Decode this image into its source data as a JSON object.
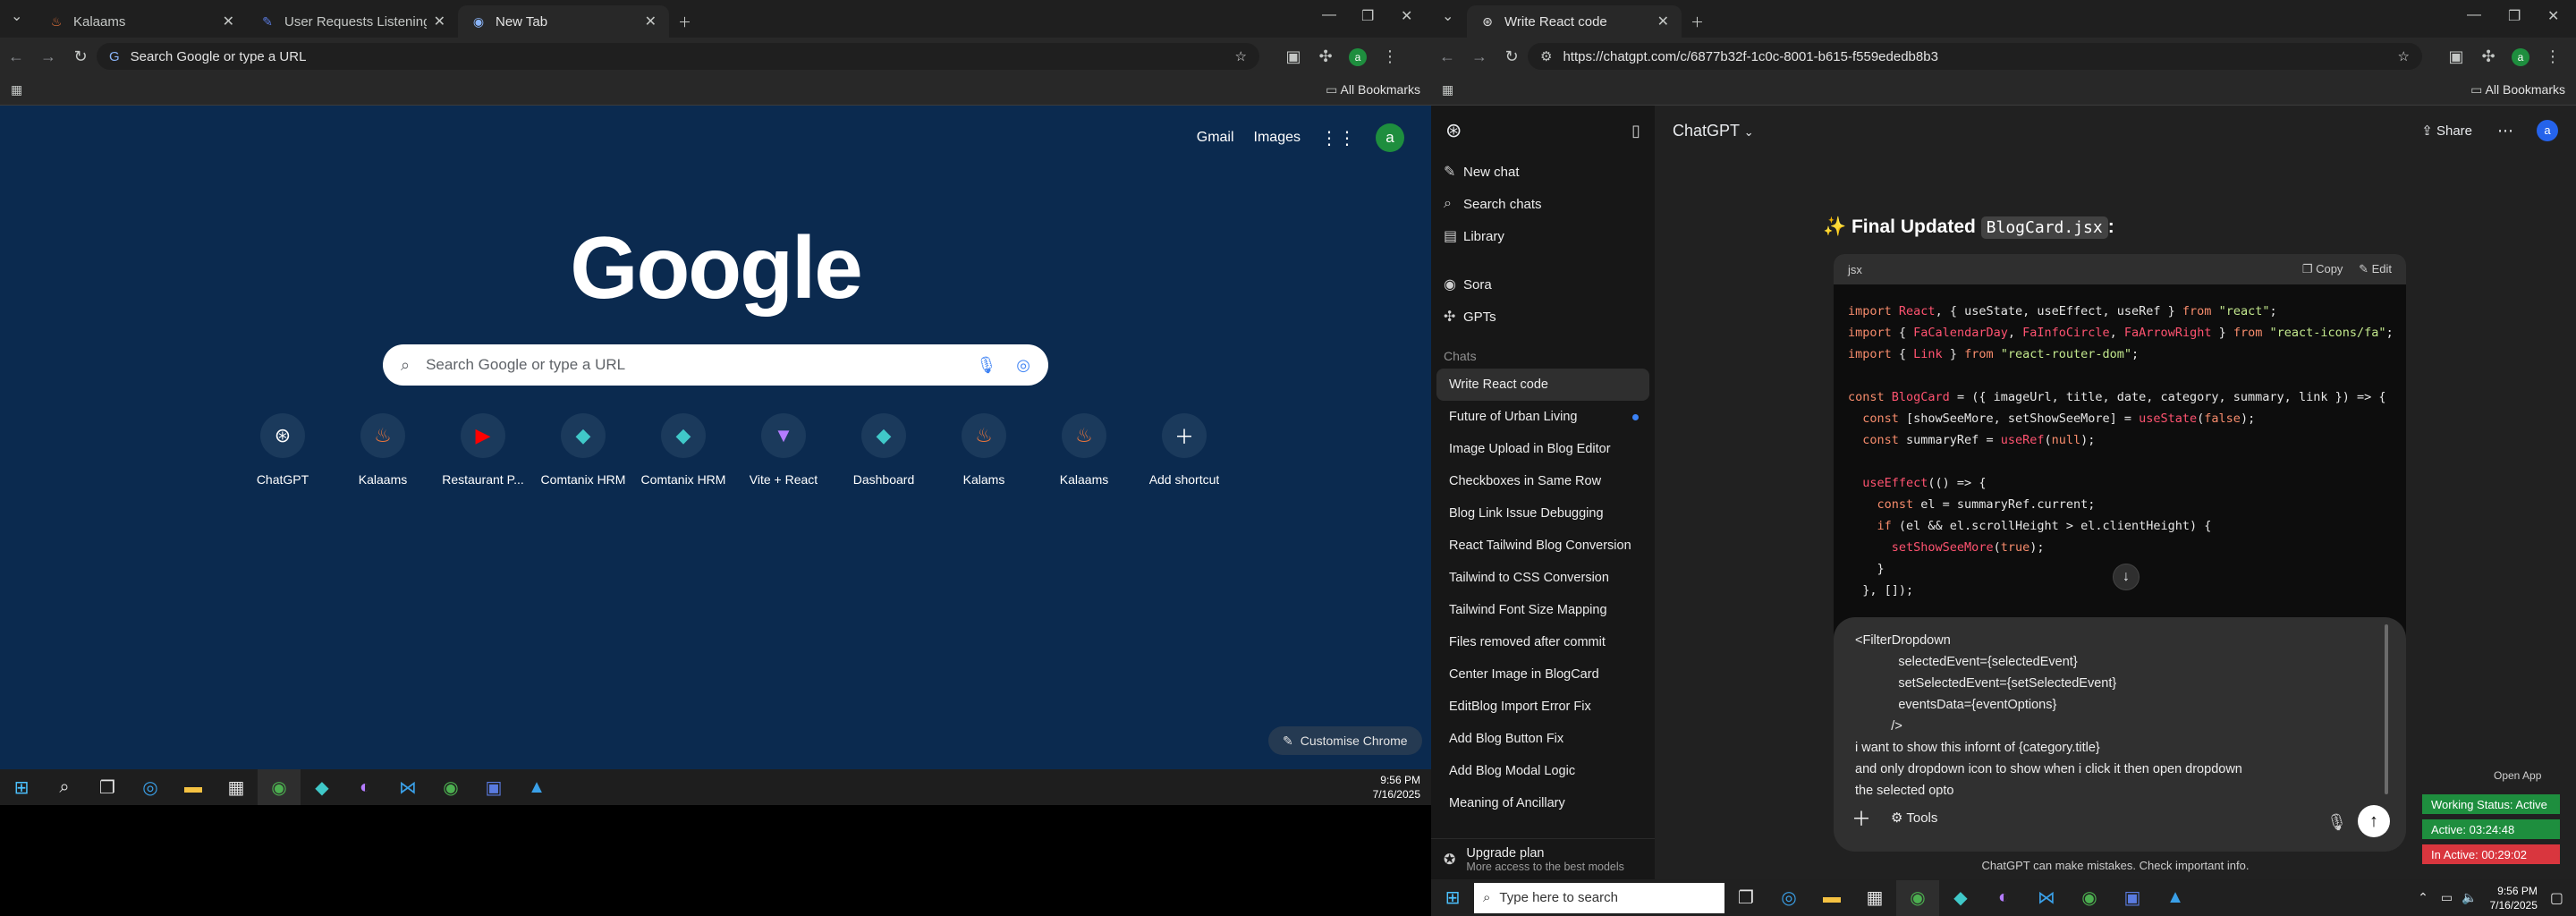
{
  "left_browser": {
    "tabs": [
      {
        "title": "Kalaams",
        "icon": "kalaams-icon"
      },
      {
        "title": "User Requests Listening Assista",
        "icon": "tools-icon"
      },
      {
        "title": "New Tab",
        "icon": "chrome-icon"
      }
    ],
    "address": "Search Google or type a URL",
    "bookmarks_label": "All Bookmarks",
    "new_tab": {
      "links": [
        "Gmail",
        "Images"
      ],
      "avatar": "a",
      "logo": "Google",
      "search_placeholder": "Search Google or type a URL",
      "shortcuts": [
        {
          "label": "ChatGPT",
          "icon": "chatgpt-icon"
        },
        {
          "label": "Kalaams",
          "icon": "kalaams-icon"
        },
        {
          "label": "Restaurant P...",
          "icon": "youtube-icon"
        },
        {
          "label": "Comtanix HRM",
          "icon": "hrm-icon"
        },
        {
          "label": "Comtanix HRM",
          "icon": "hrm-icon"
        },
        {
          "label": "Vite + React",
          "icon": "vite-icon"
        },
        {
          "label": "Dashboard",
          "icon": "hrm-icon"
        },
        {
          "label": "Kalams",
          "icon": "kalaams-icon"
        },
        {
          "label": "Kalaams",
          "icon": "kalaams-icon"
        },
        {
          "label": "Add shortcut",
          "icon": "plus-icon"
        }
      ],
      "customise": "Customise Chrome"
    },
    "clock": {
      "time": "9:56 PM",
      "date": "7/16/2025"
    }
  },
  "right_browser": {
    "tab_title": "Write React code",
    "url": "https://chatgpt.com/c/6877b32f-1c0c-8001-b615-f559ededb8b3",
    "bookmarks_label": "All Bookmarks",
    "sidebar": {
      "items": [
        "New chat",
        "Search chats",
        "Library",
        "Sora",
        "GPTs"
      ],
      "chats_label": "Chats",
      "chats": [
        "Write React code",
        "Future of Urban Living",
        "Image Upload in Blog Editor",
        "Checkboxes in Same Row",
        "Blog Link Issue Debugging",
        "React Tailwind Blog Conversion",
        "Tailwind to CSS Conversion",
        "Tailwind Font Size Mapping",
        "Files removed after commit",
        "Center Image in BlogCard",
        "EditBlog Import Error Fix",
        "Add Blog Button Fix",
        "Add Blog Modal Logic",
        "Meaning of Ancillary"
      ],
      "upgrade_title": "Upgrade plan",
      "upgrade_sub": "More access to the best models"
    },
    "main": {
      "model": "ChatGPT",
      "share": "Share",
      "heading_prefix": "✨ Final Updated",
      "heading_file": "BlogCard.jsx",
      "heading_suffix": ":",
      "code_lang": "jsx",
      "copy": "Copy",
      "edit": "Edit",
      "composer_text": "<FilterDropdown\n            selectedEvent={selectedEvent}\n            setSelectedEvent={setSelectedEvent}\n            eventsData={eventOptions}\n          />\ni want to show this infornt of {category.title}\nand only dropdown icon to show when i click it then open dropdown\nthe selected opto",
      "tools": "Tools",
      "disclaimer": "ChatGPT can make mistakes. Check important info."
    },
    "status": {
      "open_app": "Open App",
      "working": "Working Status: Active",
      "active": "Active: 03:24:48",
      "inactive": "In Active: 00:29:02"
    },
    "taskbar_search": "Type here to search",
    "clock": {
      "time": "9:56 PM",
      "date": "7/16/2025"
    }
  },
  "colors": {
    "google_bg": "#0b2a4f",
    "chat_bg": "#212121",
    "sidebar_bg": "#171717",
    "active_green": "#1e8e3e",
    "inactive_red": "#d9363e"
  }
}
